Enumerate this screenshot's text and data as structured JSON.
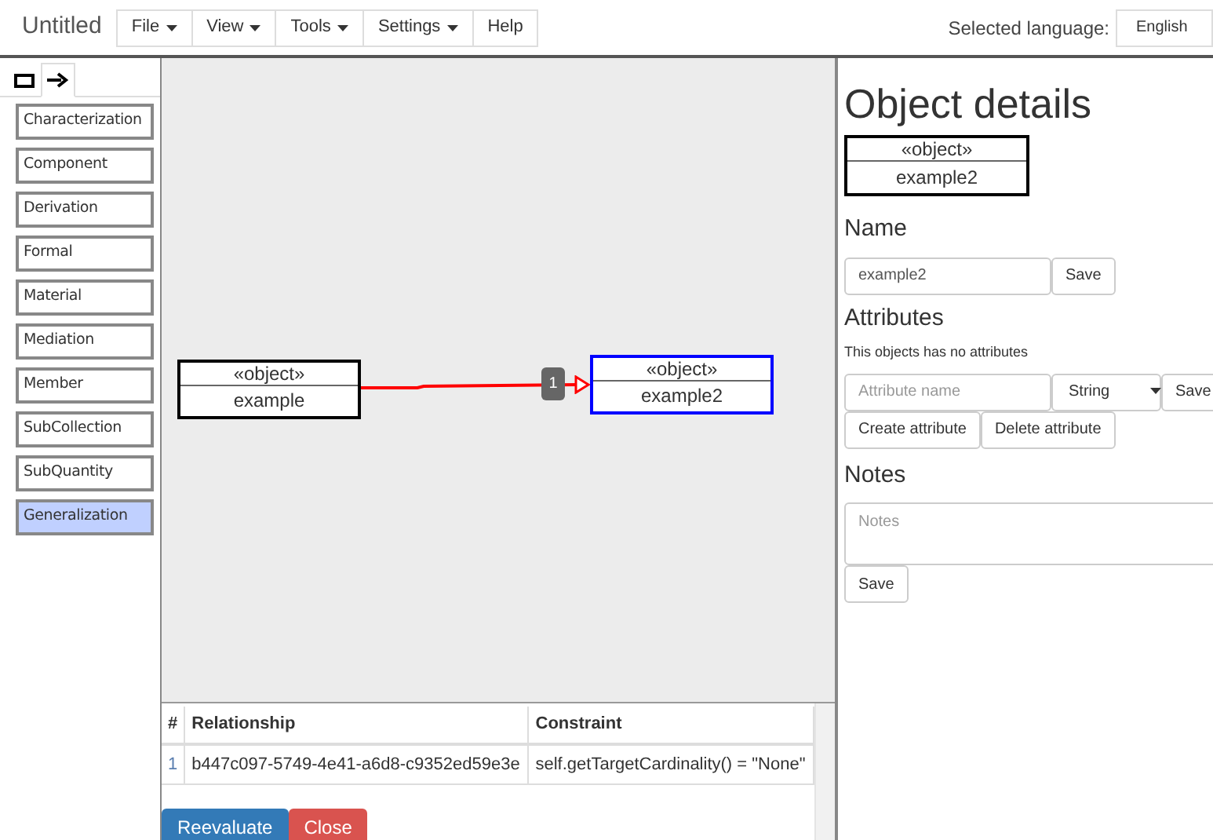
{
  "app": {
    "title": "Untitled"
  },
  "menu": [
    {
      "label": "File",
      "dropdown": true
    },
    {
      "label": "View",
      "dropdown": true
    },
    {
      "label": "Tools",
      "dropdown": true
    },
    {
      "label": "Settings",
      "dropdown": true
    },
    {
      "label": "Help",
      "dropdown": false
    }
  ],
  "language": {
    "label": "Selected language:",
    "value": "English"
  },
  "palette": {
    "tabs": [
      {
        "kind": "class",
        "selected": false
      },
      {
        "kind": "relation",
        "selected": true
      }
    ],
    "items": [
      {
        "label": "Characterization",
        "selected": false
      },
      {
        "label": "Component",
        "selected": false
      },
      {
        "label": "Derivation",
        "selected": false
      },
      {
        "label": "Formal",
        "selected": false
      },
      {
        "label": "Material",
        "selected": false
      },
      {
        "label": "Mediation",
        "selected": false
      },
      {
        "label": "Member",
        "selected": false
      },
      {
        "label": "SubCollection",
        "selected": false
      },
      {
        "label": "SubQuantity",
        "selected": false
      },
      {
        "label": "Generalization",
        "selected": true
      }
    ]
  },
  "canvas": {
    "nodes": [
      {
        "stereotype": "«object»",
        "name": "example",
        "selected": false
      },
      {
        "stereotype": "«object»",
        "name": "example2",
        "selected": true
      }
    ],
    "edges": [
      {
        "label": "1"
      }
    ]
  },
  "validation": {
    "columns": [
      "#",
      "Relationship",
      "Constraint"
    ],
    "rows": [
      [
        "1",
        "b447c097-5749-4e41-a6d8-c9352ed59e3e",
        "self.getTargetCardinality() = \"None\""
      ]
    ],
    "buttons": [
      {
        "label": "Reevaluate",
        "kind": "primary"
      },
      {
        "label": "Close",
        "kind": "danger"
      }
    ]
  },
  "details": {
    "title": "Object details",
    "preview": {
      "stereotype": "«object»",
      "name": "example2"
    },
    "name_section": {
      "heading": "Name",
      "value": "example2",
      "button": "Save"
    },
    "attributes_section": {
      "heading": "Attributes",
      "note": "This objects has no attributes",
      "placeholder": "Attribute name",
      "type": "String",
      "save": "Save",
      "buttons": [
        "Create attribute",
        "Delete attribute"
      ]
    },
    "notes_section": {
      "heading": "Notes",
      "placeholder": "Notes",
      "button": "Save"
    }
  }
}
